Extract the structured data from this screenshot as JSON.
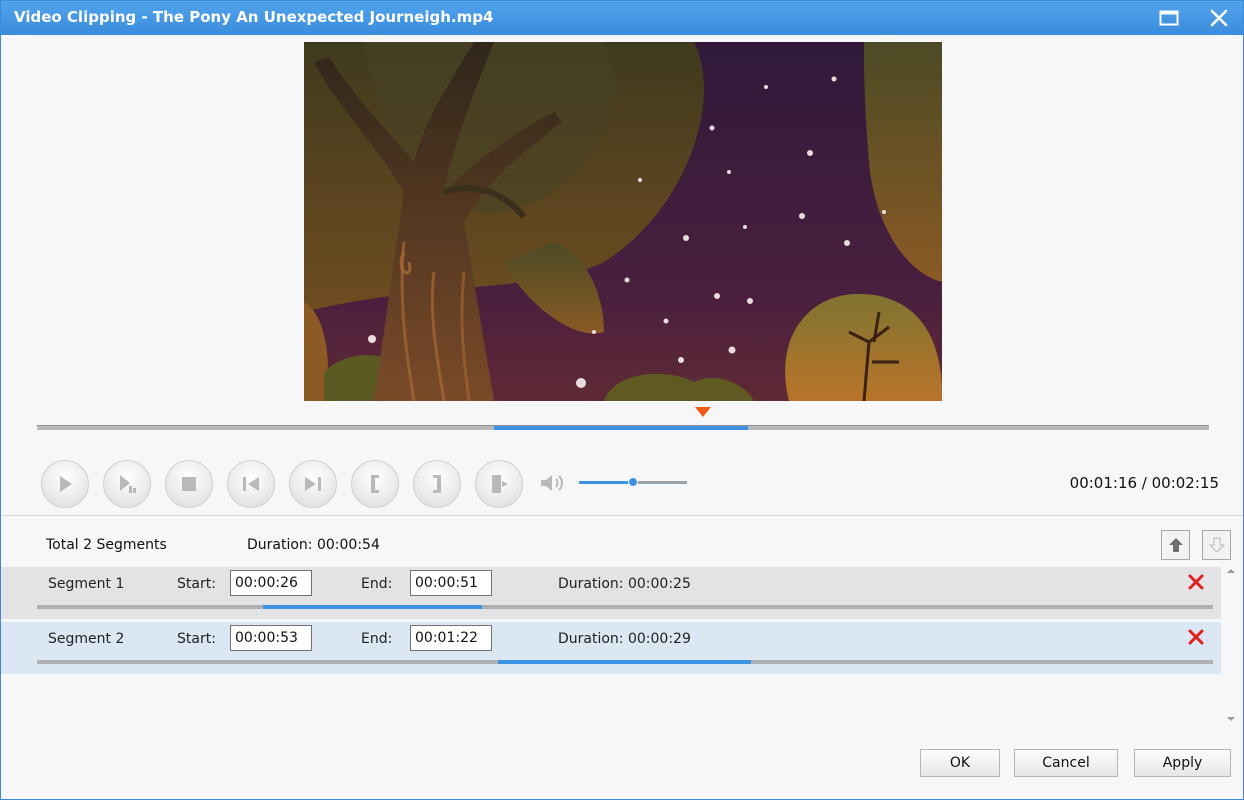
{
  "window": {
    "title": "Video Clipping - The Pony An Unexpected Journeigh.mp4",
    "accent": "#3d93e2"
  },
  "player": {
    "current_time": "00:01:16",
    "total_time": "00:02:15",
    "time_separator": " / ",
    "timeline_selection": {
      "start_fraction": 0.39,
      "end_fraction": 0.607
    },
    "playhead_fraction": 0.568,
    "volume_fraction": 0.5,
    "controls": [
      {
        "name": "play-button",
        "icon": "play-icon"
      },
      {
        "name": "play-segment-button",
        "icon": "play-segment-icon"
      },
      {
        "name": "stop-button",
        "icon": "stop-icon"
      },
      {
        "name": "previous-frame-button",
        "icon": "skip-back-icon"
      },
      {
        "name": "next-frame-button",
        "icon": "skip-forward-icon"
      },
      {
        "name": "set-start-button",
        "icon": "bracket-left-icon"
      },
      {
        "name": "set-end-button",
        "icon": "bracket-right-icon"
      },
      {
        "name": "add-segment-button",
        "icon": "add-segment-icon"
      }
    ]
  },
  "summary": {
    "segment_count": "Total 2 Segments",
    "duration_label": "Duration:",
    "duration_value": "00:00:54"
  },
  "segments": [
    {
      "name": "Segment 1",
      "start_label": "Start:",
      "start": "00:00:26",
      "end_label": "End:",
      "end": "00:00:51",
      "duration_label": "Duration:",
      "duration": "00:00:25",
      "bar": {
        "start_fraction": 0.192,
        "end_fraction": 0.378
      }
    },
    {
      "name": "Segment 2",
      "start_label": "Start:",
      "start": "00:00:53",
      "end_label": "End:",
      "end": "00:01:22",
      "duration_label": "Duration:",
      "duration": "00:00:29",
      "bar": {
        "start_fraction": 0.392,
        "end_fraction": 0.607
      }
    }
  ],
  "buttons": {
    "ok": "OK",
    "cancel": "Cancel",
    "apply": "Apply"
  }
}
